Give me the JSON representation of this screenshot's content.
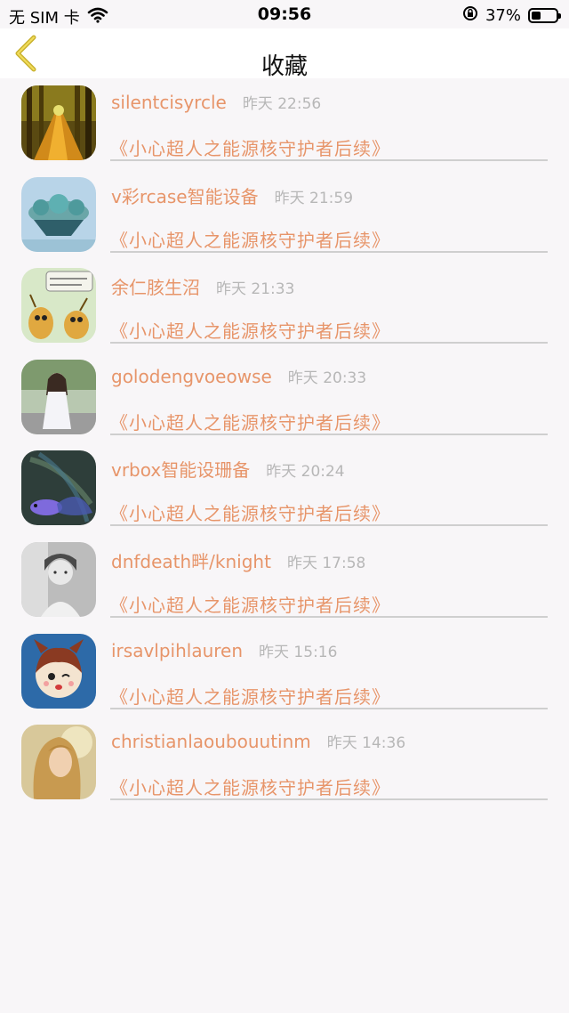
{
  "status": {
    "carrier": "无 SIM 卡",
    "time": "09:56",
    "battery": "37%",
    "battery_level": 0.37
  },
  "header": {
    "title": "收藏"
  },
  "items": [
    {
      "name": "silentcisyrcle",
      "time": "昨天 22:56",
      "book": "《小心超人之能源核守护者后续》",
      "avatar": "forest-path-avatar"
    },
    {
      "name": "v彩rcase智能设备",
      "time": "昨天 21:59",
      "book": "《小心超人之能源核守护者后续》",
      "avatar": "floating-island-avatar"
    },
    {
      "name": "余仁胲生沼",
      "time": "昨天 21:33",
      "book": "《小心超人之能源核守护者后续》",
      "avatar": "cartoon-bugs-avatar"
    },
    {
      "name": "golodengvoeowse",
      "time": "昨天 20:33",
      "book": "《小心超人之能源核守护者后续》",
      "avatar": "girl-street-avatar"
    },
    {
      "name": "vrbox智能设珊备",
      "time": "昨天 20:24",
      "book": "《小心超人之能源核守护者后续》",
      "avatar": "betta-fish-avatar"
    },
    {
      "name": "dnfdeath畔/knight",
      "time": "昨天 17:58",
      "book": "《小心超人之能源核守护者后续》",
      "avatar": "bw-portrait-avatar"
    },
    {
      "name": "irsavlpihlauren",
      "time": "昨天 15:16",
      "book": "《小心超人之能源核守护者后续》",
      "avatar": "cartoon-girl-avatar"
    },
    {
      "name": "christianlaoubouutinm",
      "time": "昨天 14:36",
      "book": "《小心超人之能源核守护者后续》",
      "avatar": "blonde-woman-avatar"
    }
  ]
}
